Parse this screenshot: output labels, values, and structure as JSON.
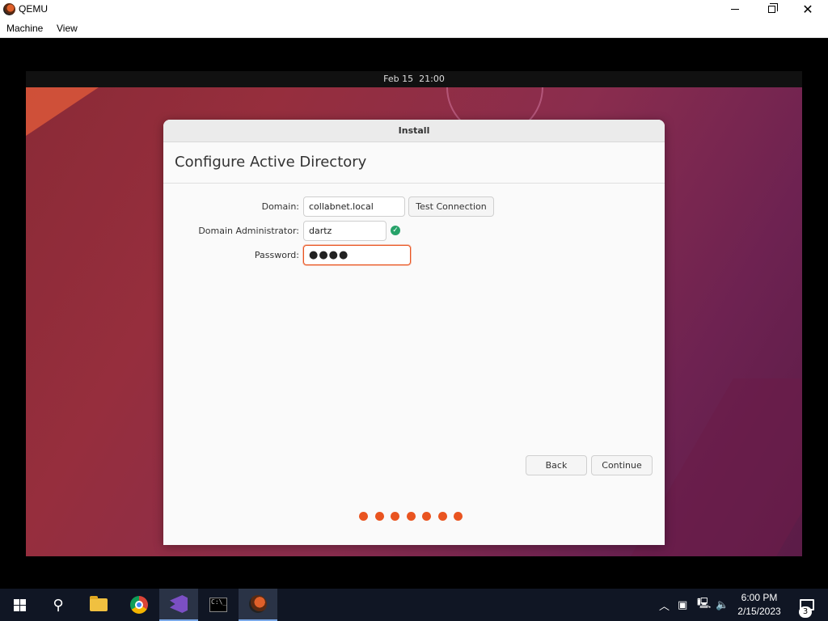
{
  "window": {
    "title": "QEMU",
    "menu": [
      "Machine",
      "View"
    ]
  },
  "guest": {
    "topbar_clock": "Feb 15  21:00",
    "dialog": {
      "header": "Install",
      "page_title": "Configure Active Directory",
      "domain_label": "Domain:",
      "domain_value": "collabnet.local",
      "test_connection_label": "Test Connection",
      "admin_label": "Domain Administrator:",
      "admin_value": "dartz",
      "admin_status": "valid",
      "password_label": "Password:",
      "password_mask": "●●●●",
      "back_label": "Back",
      "continue_label": "Continue",
      "progress_steps": 7,
      "accent_color": "#e95420"
    }
  },
  "taskbar": {
    "apps": [
      "start-icon",
      "search-icon",
      "file-explorer-icon",
      "chrome-icon",
      "visual-studio-icon",
      "terminal-icon",
      "qemu-icon"
    ],
    "clock_time": "6:00 PM",
    "clock_date": "2/15/2023",
    "notification_count": "3"
  }
}
